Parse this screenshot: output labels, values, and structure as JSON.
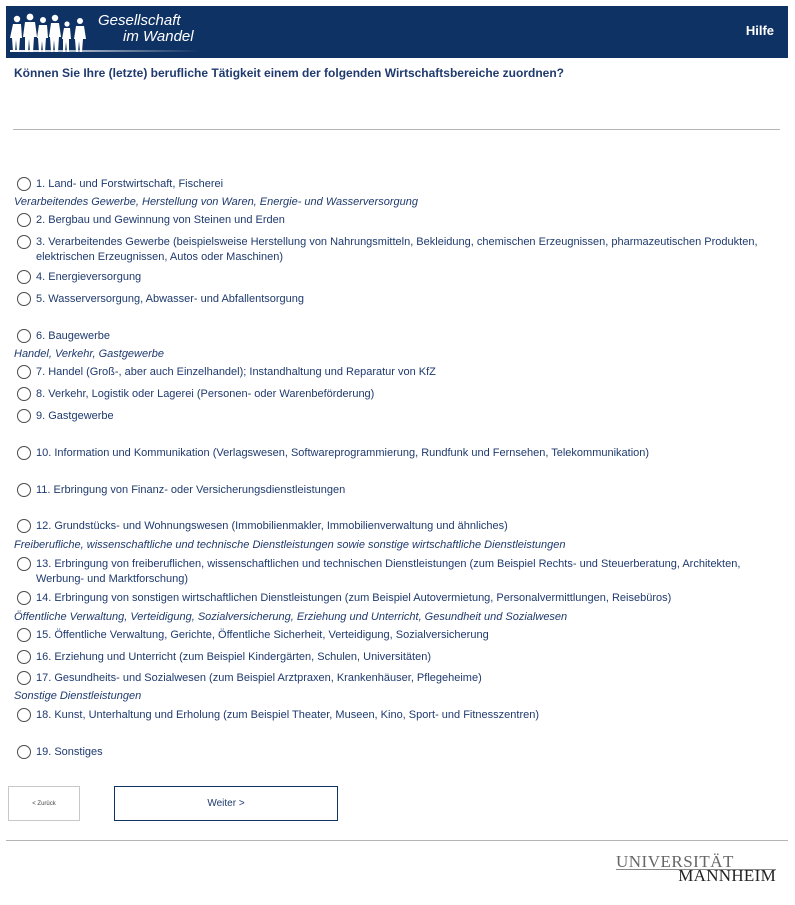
{
  "header": {
    "logo_line1": "Gesellschaft",
    "logo_line2": "im Wandel",
    "help_label": "Hilfe"
  },
  "question": "Können Sie Ihre (letzte) berufliche Tätigkeit einem der folgenden Wirtschaftsbereiche zuordnen?",
  "categories": [
    "Verarbeitendes Gewerbe, Herstellung von Waren, Energie- und Wasserversorgung",
    "Handel, Verkehr, Gastgewerbe",
    "Freiberufliche, wissenschaftliche und technische Dienstleistungen sowie sonstige wirtschaftliche Dienstleistungen",
    "Öffentliche Verwaltung, Verteidigung, Sozialversicherung, Erziehung und Unterricht, Gesundheit und Sozialwesen",
    "Sonstige Dienstleistungen"
  ],
  "options": [
    "1. Land- und Forstwirtschaft, Fischerei",
    "2. Bergbau und Gewinnung von Steinen und Erden",
    "3. Verarbeitendes Gewerbe (beispielsweise Herstellung von Nahrungsmitteln, Bekleidung, chemischen Erzeugnissen, pharmazeutischen Produkten, elektrischen Erzeugnissen, Autos oder Maschinen)",
    "4. Energieversorgung",
    "5. Wasserversorgung, Abwasser- und Abfallentsorgung",
    "6. Baugewerbe",
    "7. Handel (Groß-, aber auch Einzelhandel); Instandhaltung und Reparatur von KfZ",
    "8. Verkehr, Logistik oder Lagerei (Personen- oder Warenbeförderung)",
    "9. Gastgewerbe",
    "10. Information und Kommunikation (Verlagswesen, Softwareprogrammierung, Rundfunk und Fernsehen, Telekommunikation)",
    "11. Erbringung von Finanz- oder Versicherungsdienstleistungen",
    "12. Grundstücks- und Wohnungswesen (Immobilienmakler, Immobilienverwaltung und ähnliches)",
    "13. Erbringung von freiberuflichen, wissenschaftlichen und technischen Dienstleistungen (zum Beispiel Rechts- und Steuerberatung, Architekten, Werbung- und Marktforschung)",
    "14. Erbringung von sonstigen wirtschaftlichen Dienstleistungen (zum Beispiel Autovermietung, Personalvermittlungen, Reisebüros)",
    "15. Öffentliche Verwaltung, Gerichte, Öffentliche Sicherheit, Verteidigung, Sozialversicherung",
    "16. Erziehung und Unterricht (zum Beispiel Kindergärten, Schulen, Universitäten)",
    "17. Gesundheits- und Sozialwesen (zum Beispiel Arztpraxen, Krankenhäuser, Pflegeheime)",
    "18. Kunst, Unterhaltung und Erholung (zum Beispiel Theater, Museen, Kino, Sport- und Fitnesszentren)",
    "19. Sonstiges"
  ],
  "buttons": {
    "back_label": "< Zurück",
    "next_label": "Weiter >"
  },
  "university_logo": {
    "line1": "UNIVERSITÄT",
    "line2": "MANNHEIM"
  },
  "colors": {
    "header_bg": "#0f3264",
    "text": "#1f3a6e"
  }
}
